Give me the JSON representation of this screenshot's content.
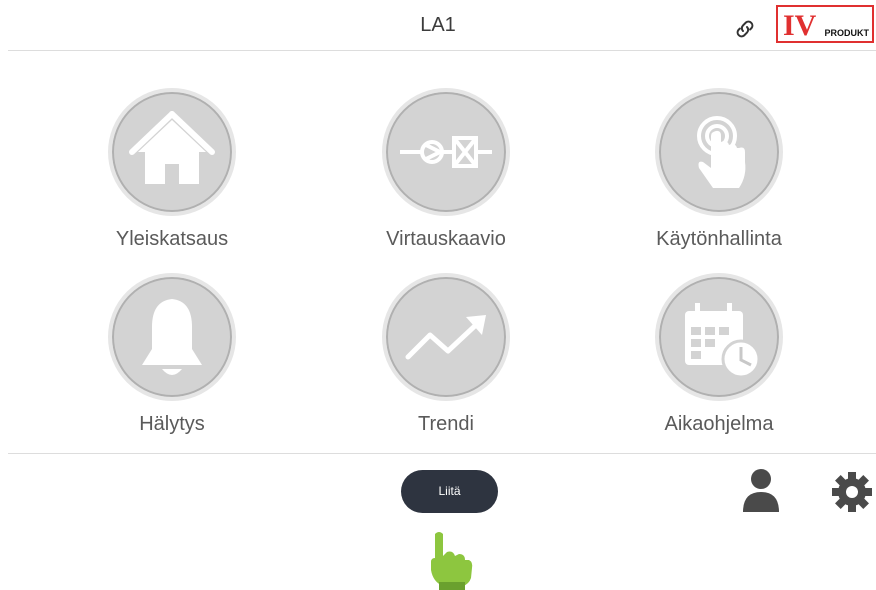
{
  "header": {
    "title": "LA1",
    "logo_text": "PRODUKT",
    "logo_mark": "IV"
  },
  "tiles": [
    {
      "label": "Yleiskatsaus",
      "icon": "home-icon"
    },
    {
      "label": "Virtauskaavio",
      "icon": "flow-diagram-icon"
    },
    {
      "label": "Käytönhallinta",
      "icon": "touch-hand-icon"
    },
    {
      "label": "Hälytys",
      "icon": "bell-icon"
    },
    {
      "label": "Trendi",
      "icon": "trend-icon"
    },
    {
      "label": "Aikaohjelma",
      "icon": "calendar-clock-icon"
    }
  ],
  "footer": {
    "connect_label": "Liitä",
    "icons": [
      "user-icon",
      "gear-icon"
    ]
  },
  "pointer": {
    "icon": "pointing-hand-icon",
    "color": "#8dc63f"
  },
  "colors": {
    "tile_bg": "#d3d3d3",
    "pill_bg": "#2e3440",
    "logo_border": "#e03030"
  }
}
